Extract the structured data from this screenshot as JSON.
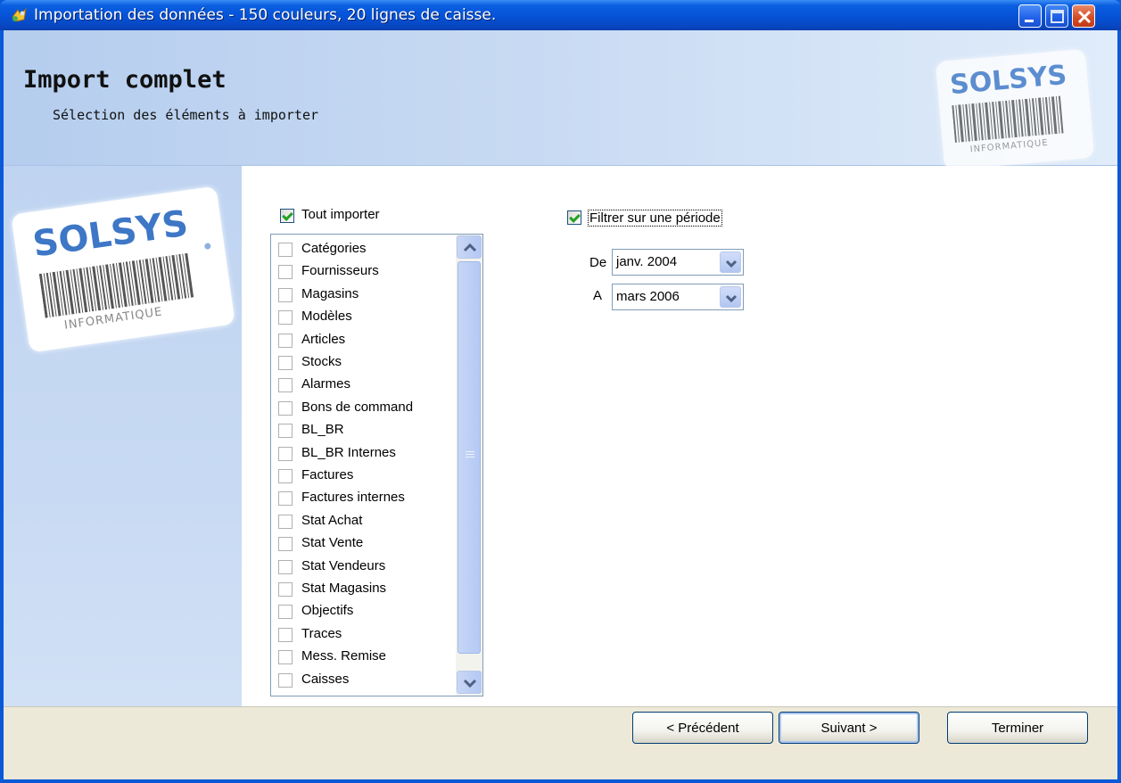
{
  "window": {
    "title": "Importation des données - 150 couleurs, 20 lignes de caisse."
  },
  "header": {
    "title": "Import complet",
    "subtitle": "Sélection des éléments à importer"
  },
  "logo": {
    "brand": "SOLSYS",
    "tagline": "INFORMATIQUE"
  },
  "import_all": {
    "label": "Tout importer",
    "checked": true
  },
  "items": [
    {
      "label": "Catégories",
      "checked": false
    },
    {
      "label": "Fournisseurs",
      "checked": false
    },
    {
      "label": "Magasins",
      "checked": false
    },
    {
      "label": "Modèles",
      "checked": false
    },
    {
      "label": "Articles",
      "checked": false
    },
    {
      "label": "Stocks",
      "checked": false
    },
    {
      "label": "Alarmes",
      "checked": false
    },
    {
      "label": "Bons de command",
      "checked": false
    },
    {
      "label": "BL_BR",
      "checked": false
    },
    {
      "label": "BL_BR Internes",
      "checked": false
    },
    {
      "label": "Factures",
      "checked": false
    },
    {
      "label": "Factures internes",
      "checked": false
    },
    {
      "label": "Stat Achat",
      "checked": false
    },
    {
      "label": "Stat Vente",
      "checked": false
    },
    {
      "label": "Stat Vendeurs",
      "checked": false
    },
    {
      "label": "Stat Magasins",
      "checked": false
    },
    {
      "label": "Objectifs",
      "checked": false
    },
    {
      "label": "Traces",
      "checked": false
    },
    {
      "label": "Mess. Remise",
      "checked": false
    },
    {
      "label": "Caisses",
      "checked": false
    }
  ],
  "period_filter": {
    "label": "Filtrer sur une période",
    "checked": true,
    "from_label": "De",
    "from_value": "janv. 2004",
    "to_label": "A",
    "to_value": "mars 2006"
  },
  "buttons": {
    "previous": "< Précédent",
    "next": "Suivant >",
    "finish": "Terminer"
  },
  "colors": {
    "titlebar": "#0a5fe0",
    "header_bg": "#c9dbf3",
    "sidebar_bg": "#c8daf3",
    "footer_bg": "#ece9d8",
    "brand": "#3d77c6",
    "checkmark": "#21a121"
  }
}
